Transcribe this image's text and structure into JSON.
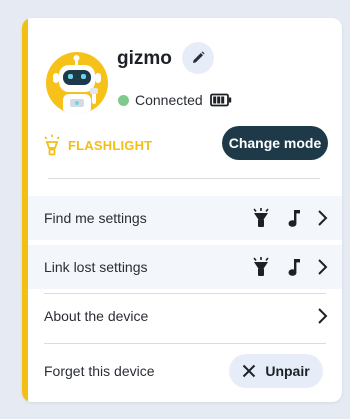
{
  "device": {
    "name": "gizmo",
    "status": "Connected",
    "mode": "FLASHLIGHT",
    "change_mode_label": "Change mode"
  },
  "menu": {
    "items": [
      {
        "label": "Find me settings"
      },
      {
        "label": "Link lost settings"
      },
      {
        "label": "About the device"
      },
      {
        "label": "Forget this device"
      }
    ],
    "unpair_label": "Unpair"
  },
  "colors": {
    "accent": "#f2bf14",
    "connected": "#7fc98c",
    "primary_button": "#1e3a48",
    "secondary_button": "#e6edf8"
  },
  "icons": [
    "robot-avatar-icon",
    "pencil-icon",
    "battery-icon",
    "lightbulb-icon",
    "flashlight-icon",
    "music-note-icon",
    "chevron-right-icon",
    "close-icon"
  ]
}
